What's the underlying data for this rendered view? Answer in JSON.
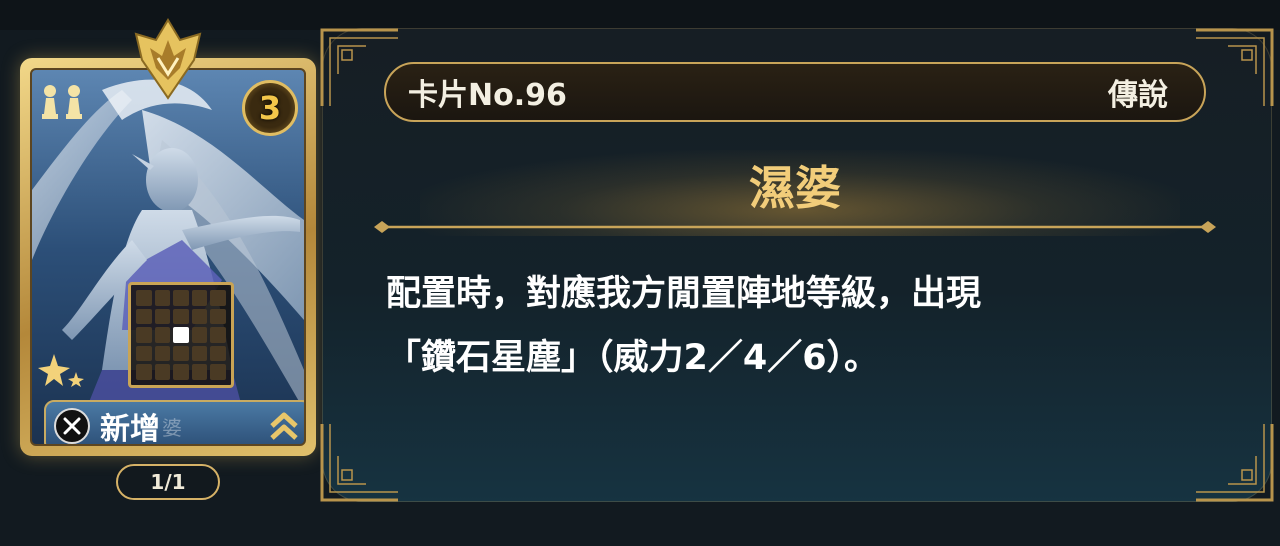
{
  "card": {
    "cost": "3",
    "add_label": "新增",
    "ghost_label": "婆",
    "pattern": [
      [
        0,
        0,
        0,
        0,
        0
      ],
      [
        0,
        0,
        0,
        0,
        0
      ],
      [
        0,
        0,
        1,
        0,
        0
      ],
      [
        0,
        0,
        0,
        0,
        0
      ],
      [
        0,
        0,
        0,
        0,
        0
      ]
    ],
    "count": "1/1",
    "icons": {
      "crown": "crown-emblem-icon",
      "pawns": "pawn-icon",
      "stars": "star-rank-icon",
      "close": "x-button-icon",
      "upgrade": "double-chevron-up-icon"
    }
  },
  "info": {
    "card_no": "卡片No.96",
    "rarity": "傳說",
    "name": "濕婆",
    "description_line1": "配置時，對應我方閒置陣地等級，出現",
    "description_line2": "「鑽石星塵」（威力2／4／6）。"
  },
  "colors": {
    "gold": "#c8a459",
    "name_gold": "#f2cd7a",
    "panel_bg": "#161e24"
  }
}
